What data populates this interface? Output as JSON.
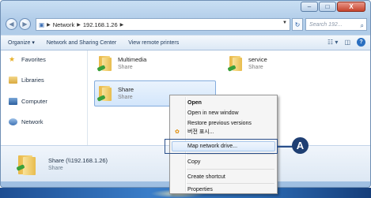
{
  "window": {
    "caption": {
      "minimize": "–",
      "maximize": "□",
      "close": "X"
    }
  },
  "nav": {
    "back_icon": "arrow-left-icon",
    "forward_icon": "arrow-right-icon",
    "breadcrumb": [
      "Network",
      "192.168.1.26"
    ],
    "search_placeholder": "Search 192..."
  },
  "toolbar": {
    "organize": "Organize ▾",
    "network_sharing": "Network and Sharing Center",
    "view_remote": "View remote printers"
  },
  "sidebar": {
    "items": [
      {
        "label": "Favorites",
        "icon": "star-icon"
      },
      {
        "label": "Libraries",
        "icon": "library-icon"
      },
      {
        "label": "Computer",
        "icon": "computer-icon"
      },
      {
        "label": "Network",
        "icon": "network-icon"
      }
    ]
  },
  "folders": [
    {
      "name": "Multimedia",
      "type": "Share"
    },
    {
      "name": "service",
      "type": "Share"
    },
    {
      "name": "Share",
      "type": "Share"
    }
  ],
  "details": {
    "name": "Share (\\\\192.168.1.26)",
    "type": "Share"
  },
  "context_menu": {
    "items": [
      "Open",
      "Open in new window",
      "Restore previous versions",
      "버전 표시...",
      "Map network drive...",
      "Copy",
      "Create shortcut",
      "Properties"
    ]
  },
  "callout": {
    "label": "A"
  }
}
